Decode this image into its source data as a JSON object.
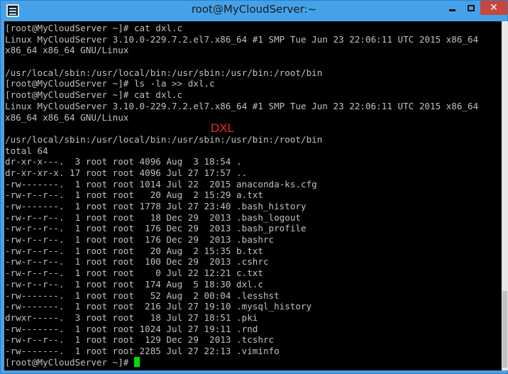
{
  "window": {
    "title": "root@MyCloudServer:~",
    "controls": {
      "minimize_icon": "minimize-icon",
      "maximize_icon": "maximize-icon",
      "close_icon": "close-icon",
      "close_glyph": "✕"
    },
    "colors": {
      "titlebar": "#45a2ea",
      "close": "#c7463c",
      "terminal_bg": "#000000",
      "terminal_text": "#c0c0c0",
      "cursor": "#00e000",
      "annotation": "#e8322a"
    }
  },
  "terminal": {
    "lines": [
      "[root@MyCloudServer ~]# cat dxl.c",
      "Linux MyCloudServer 3.10.0-229.7.2.el7.x86_64 #1 SMP Tue Jun 23 22:06:11 UTC 2015 x86_64",
      "x86_64 x86_64 GNU/Linux",
      "",
      "/usr/local/sbin:/usr/local/bin:/usr/sbin:/usr/bin:/root/bin",
      "[root@MyCloudServer ~]# ls -la >> dxl.c",
      "[root@MyCloudServer ~]# cat dxl.c",
      "Linux MyCloudServer 3.10.0-229.7.2.el7.x86_64 #1 SMP Tue Jun 23 22:06:11 UTC 2015 x86_64",
      "x86_64 x86_64 GNU/Linux",
      "",
      "/usr/local/sbin:/usr/local/bin:/usr/sbin:/usr/bin:/root/bin",
      "total 64",
      "dr-xr-x---.  3 root root 4096 Aug  3 18:54 .",
      "dr-xr-xr-x. 17 root root 4096 Jul 27 17:57 ..",
      "-rw-------.  1 root root 1014 Jul 22  2015 anaconda-ks.cfg",
      "-rw-r--r--.  1 root root   20 Aug  2 15:29 a.txt",
      "-rw-------.  1 root root 1778 Jul 27 23:40 .bash_history",
      "-rw-r--r--.  1 root root   18 Dec 29  2013 .bash_logout",
      "-rw-r--r--.  1 root root  176 Dec 29  2013 .bash_profile",
      "-rw-r--r--.  1 root root  176 Dec 29  2013 .bashrc",
      "-rw-r--r--.  1 root root   20 Aug  2 15:35 b.txt",
      "-rw-r--r--.  1 root root  100 Dec 29  2013 .cshrc",
      "-rw-r--r--.  1 root root    0 Jul 22 12:21 c.txt",
      "-rw-r--r--.  1 root root  174 Aug  5 18:30 dxl.c",
      "-rw-------.  1 root root   52 Aug  2 00:04 .lesshst",
      "-rw-------.  1 root root  216 Jul 27 19:10 .mysql_history",
      "drwxr-----.  3 root root   18 Jul 27 18:51 .pki",
      "-rw-------.  1 root root 1024 Jul 27 19:11 .rnd",
      "-rw-r--r--.  1 root root  129 Dec 29  2013 .tcshrc",
      "-rw-------.  1 root root 2285 Jul 27 22:13 .viminfo"
    ],
    "prompt": "[root@MyCloudServer ~]# "
  },
  "annotation": {
    "text": "DXL"
  }
}
